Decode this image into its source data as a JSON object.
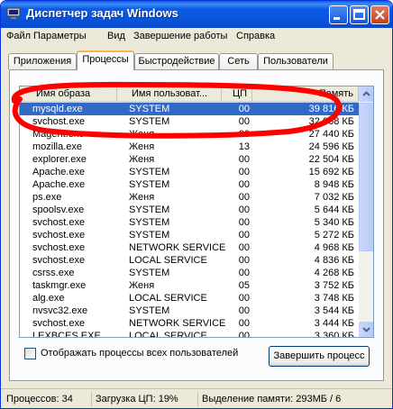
{
  "window": {
    "title": "Диспетчер задач Windows",
    "title_icon": "task-manager-icon",
    "controls": [
      "minimize-icon",
      "maximize-icon",
      "close-icon"
    ]
  },
  "menu": [
    {
      "label": "Файл"
    },
    {
      "label": "Параметры"
    },
    {
      "label": "Вид"
    },
    {
      "label": "Завершение работы"
    },
    {
      "label": "Справка"
    }
  ],
  "tabs": [
    {
      "label": "Приложения",
      "active": false
    },
    {
      "label": "Процессы",
      "active": true
    },
    {
      "label": "Быстродействие",
      "active": false
    },
    {
      "label": "Сеть",
      "active": false
    },
    {
      "label": "Пользователи",
      "active": false
    }
  ],
  "table": {
    "columns": [
      "Имя образа",
      "Имя пользоват...",
      "ЦП",
      "Память"
    ],
    "rows": [
      {
        "name": "mysqld.exe",
        "user": "SYSTEM",
        "cpu": "00",
        "mem": "39 816 КБ",
        "selected": true
      },
      {
        "name": "svchost.exe",
        "user": "SYSTEM",
        "cpu": "00",
        "mem": "32 068 КБ"
      },
      {
        "name": "Magent.exe",
        "user": "Женя",
        "cpu": "00",
        "mem": "27 440 КБ"
      },
      {
        "name": "mozilla.exe",
        "user": "Женя",
        "cpu": "13",
        "mem": "24 596 КБ"
      },
      {
        "name": "explorer.exe",
        "user": "Женя",
        "cpu": "00",
        "mem": "22 504 КБ"
      },
      {
        "name": "Apache.exe",
        "user": "SYSTEM",
        "cpu": "00",
        "mem": "15 692 КБ"
      },
      {
        "name": "Apache.exe",
        "user": "SYSTEM",
        "cpu": "00",
        "mem": "8 948 КБ"
      },
      {
        "name": "ps.exe",
        "user": "Женя",
        "cpu": "00",
        "mem": "7 032 КБ"
      },
      {
        "name": "spoolsv.exe",
        "user": "SYSTEM",
        "cpu": "00",
        "mem": "5 644 КБ"
      },
      {
        "name": "svchost.exe",
        "user": "SYSTEM",
        "cpu": "00",
        "mem": "5 340 КБ"
      },
      {
        "name": "svchost.exe",
        "user": "SYSTEM",
        "cpu": "00",
        "mem": "5 272 КБ"
      },
      {
        "name": "svchost.exe",
        "user": "NETWORK SERVICE",
        "cpu": "00",
        "mem": "4 968 КБ"
      },
      {
        "name": "svchost.exe",
        "user": "LOCAL SERVICE",
        "cpu": "00",
        "mem": "4 836 КБ"
      },
      {
        "name": "csrss.exe",
        "user": "SYSTEM",
        "cpu": "00",
        "mem": "4 268 КБ"
      },
      {
        "name": "taskmgr.exe",
        "user": "Женя",
        "cpu": "05",
        "mem": "3 752 КБ"
      },
      {
        "name": "alg.exe",
        "user": "LOCAL SERVICE",
        "cpu": "00",
        "mem": "3 748 КБ"
      },
      {
        "name": "nvsvc32.exe",
        "user": "SYSTEM",
        "cpu": "00",
        "mem": "3 544 КБ"
      },
      {
        "name": "svchost.exe",
        "user": "NETWORK SERVICE",
        "cpu": "00",
        "mem": "3 444 КБ"
      },
      {
        "name": "LEXBCES.EXE",
        "user": "LOCAL SERVICE",
        "cpu": "00",
        "mem": "3 360 КБ"
      }
    ]
  },
  "show_all_processes": {
    "label": "Отображать процессы всех пользователей",
    "checked": false
  },
  "end_process_button": "Завершить процесс",
  "status": {
    "processes": "Процессов: 34",
    "cpu": "Загрузка ЦП: 19%",
    "memory": "Выделение памяти: 293МБ / 6"
  },
  "colors": {
    "title_bar": "#0854dd",
    "selection": "#316ac5",
    "annotation": "#ff0000"
  }
}
